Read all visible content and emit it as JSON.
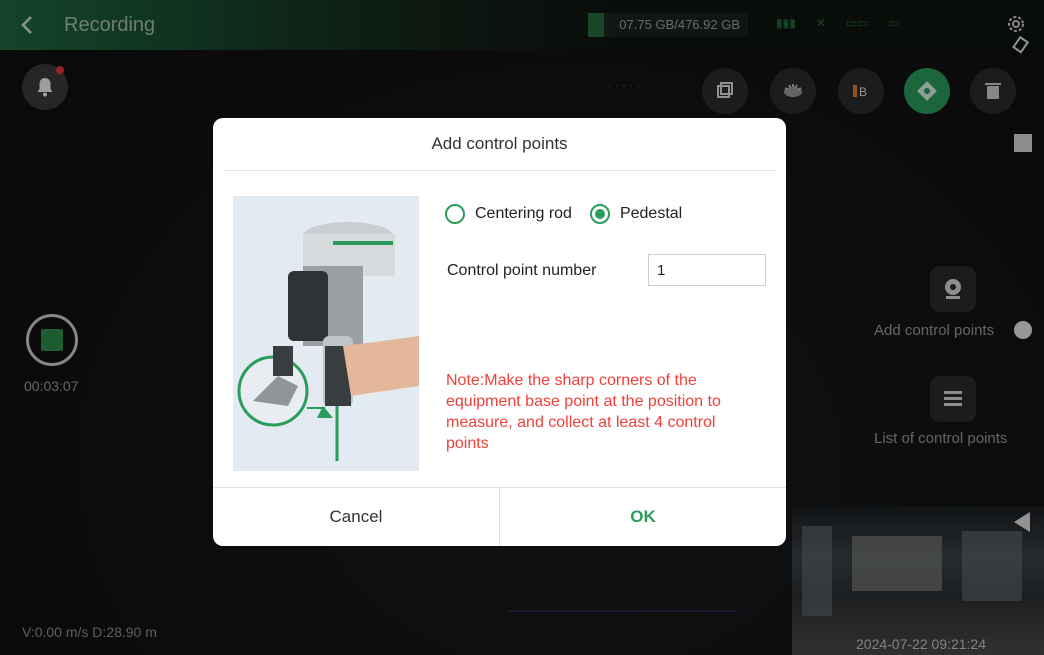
{
  "topbar": {
    "title": "Recording",
    "storage": "07.75 GB/476.92 GB"
  },
  "left": {
    "timer": "00:03:07",
    "speed": "V:0.00 m/s  D:28.90 m"
  },
  "right_panel": {
    "add_cp_label": "Add control points",
    "list_cp_label": "List of control points",
    "camera_timestamp": "2024-07-22 09:21:24"
  },
  "dialog": {
    "title": "Add control points",
    "radio_centering": "Centering rod",
    "radio_pedestal": "Pedestal",
    "selected": "Pedestal",
    "cp_number_label": "Control point number",
    "cp_number_value": "1",
    "note": "Note:Make the sharp corners of the equipment base point at the position to measure, and collect at least 4 control points",
    "cancel": "Cancel",
    "ok": "OK"
  },
  "colors": {
    "accent": "#2a9d5c",
    "warning": "#f0403a"
  },
  "icons": [
    "back-icon",
    "settings-icon",
    "rotate-icon",
    "bell-icon",
    "cube-icon",
    "eye-icon",
    "layers-icon",
    "target-icon",
    "trash-icon",
    "control-point-icon",
    "list-icon"
  ]
}
